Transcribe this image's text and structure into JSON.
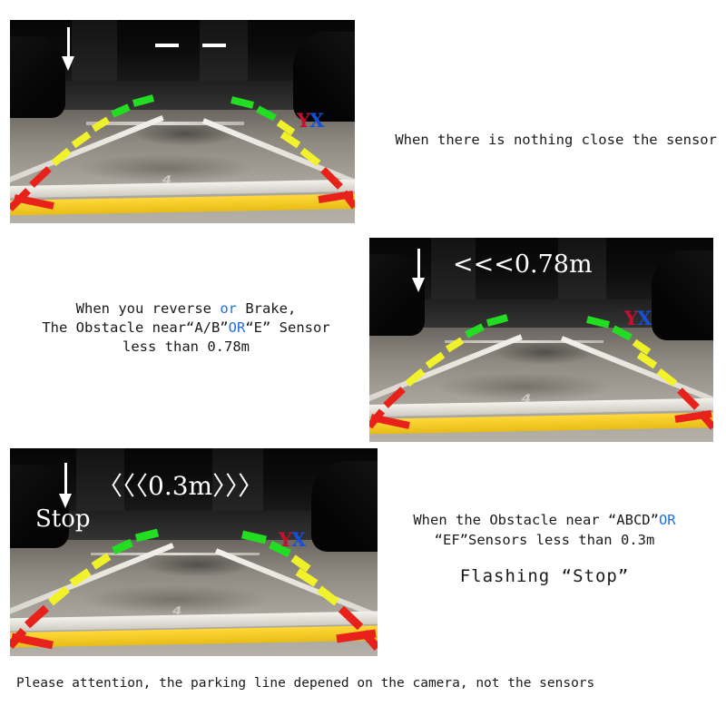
{
  "page": {
    "footer_note": "Please attention, the parking line depened on the camera, not the sensors"
  },
  "colors": {
    "accent_blue": "#1f6fe0",
    "logo_red": "#c8102e",
    "logo_blue": "#1550d8",
    "guide_green": "#22dd22",
    "guide_yellow": "#f2f22a",
    "guide_red": "#e8211b",
    "hud_white": "#ffffff"
  },
  "panels": [
    {
      "id": "panel-no-obstacle",
      "camera": {
        "arrow_icon": "down-arrow-icon",
        "distance_display": "—  —",
        "distance_is_dashes": true,
        "logo": {
          "first": "Y",
          "second": "X"
        },
        "floor_marking": "4",
        "guide_segments": {
          "green": "far",
          "yellow": "middle",
          "red": "near"
        }
      },
      "caption": {
        "line1": "When there is nothing close the sensor"
      }
    },
    {
      "id": "panel-078m",
      "camera": {
        "arrow_icon": "down-arrow-icon",
        "distance_display": "<<<0.78m",
        "logo": {
          "first": "Y",
          "second": "X"
        },
        "floor_marking": "4",
        "guide_segments": {
          "green": "far",
          "yellow": "middle",
          "red": "near"
        }
      },
      "caption": {
        "line1_a": "When you reverse ",
        "line1_or": "or",
        "line1_b": " Brake,",
        "line2_a": "The Obstacle near“A/B”",
        "line2_or": "OR",
        "line2_b": "“E” Sensor",
        "line3": "less than 0.78m"
      }
    },
    {
      "id": "panel-03m",
      "camera": {
        "arrow_icon": "down-arrow-icon",
        "distance_display": "〈〈〈0.3m〉〉〉",
        "stop_label": "Stop",
        "logo": {
          "first": "Y",
          "second": "X"
        },
        "floor_marking": "4",
        "guide_segments": {
          "green": "far",
          "yellow": "middle",
          "red": "near"
        }
      },
      "caption": {
        "line1_a": "When the Obstacle near “ABCD”",
        "line1_or": "OR",
        "line2": "“EF”Sensors less than 0.3m",
        "line3": "Flashing “Stop”"
      }
    }
  ]
}
